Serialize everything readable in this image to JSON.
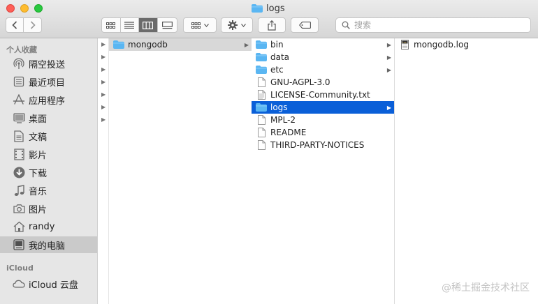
{
  "window": {
    "title": "logs"
  },
  "toolbar": {
    "back": "‹",
    "forward": "›",
    "search_placeholder": "搜索"
  },
  "sidebar": {
    "favorites_header": "个人收藏",
    "items": [
      {
        "label": "隔空投送",
        "icon": "airdrop-icon"
      },
      {
        "label": "最近项目",
        "icon": "recents-icon"
      },
      {
        "label": "应用程序",
        "icon": "applications-icon"
      },
      {
        "label": "桌面",
        "icon": "desktop-icon"
      },
      {
        "label": "文稿",
        "icon": "documents-icon"
      },
      {
        "label": "影片",
        "icon": "movies-icon"
      },
      {
        "label": "下载",
        "icon": "downloads-icon"
      },
      {
        "label": "音乐",
        "icon": "music-icon"
      },
      {
        "label": "图片",
        "icon": "pictures-icon"
      },
      {
        "label": "randy",
        "icon": "home-icon"
      },
      {
        "label": "我的电脑",
        "icon": "computer-icon"
      }
    ],
    "icloud_header": "iCloud",
    "icloud_items": [
      {
        "label": "iCloud 云盘",
        "icon": "cloud-icon"
      }
    ]
  },
  "columns": {
    "col2": [
      {
        "name": "mongodb",
        "kind": "folder"
      }
    ],
    "col3": [
      {
        "name": "bin",
        "kind": "folder"
      },
      {
        "name": "data",
        "kind": "folder"
      },
      {
        "name": "etc",
        "kind": "folder"
      },
      {
        "name": "GNU-AGPL-3.0",
        "kind": "file"
      },
      {
        "name": "LICENSE-Community.txt",
        "kind": "text"
      },
      {
        "name": "logs",
        "kind": "folder"
      },
      {
        "name": "MPL-2",
        "kind": "file"
      },
      {
        "name": "README",
        "kind": "file"
      },
      {
        "name": "THIRD-PARTY-NOTICES",
        "kind": "file"
      }
    ],
    "col4": [
      {
        "name": "mongodb.log",
        "kind": "log"
      }
    ]
  },
  "watermark": "@稀土掘金技术社区",
  "colors": {
    "accent": "#0a5fd8",
    "folder": "#5ab6f2"
  }
}
